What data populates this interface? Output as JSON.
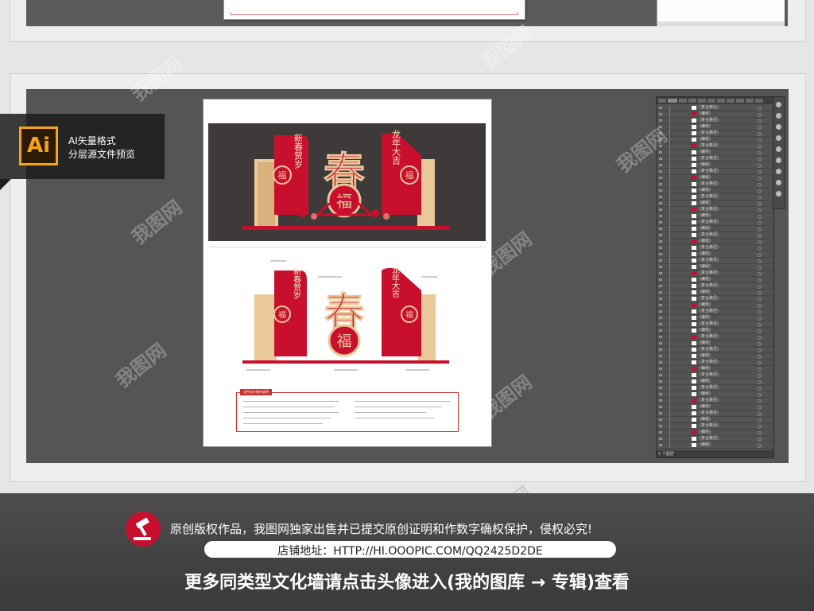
{
  "badge": {
    "logo_text": "Ai",
    "line1": "AI矢量格式",
    "line2": "分层源文件预览"
  },
  "watermark": "我图网",
  "design": {
    "main_character": "春",
    "fu_character": "福",
    "left_banner": "新春贺岁",
    "right_banner": "龙年大吉",
    "plan_title": "文件设计制作说明"
  },
  "layers_panel": {
    "footer_text": "1 个图层",
    "layer_names": [
      "(复合路径)",
      "(编组)"
    ]
  },
  "footer": {
    "copyright": "原创版权作品，我图网独家出售并已提交原创证明和作数字确权保护，侵权必究!",
    "shop_label": "店铺地址：HTTP://HI.OOOPIC.COM/QQ2425D2DE",
    "more": "更多同类型文化墙请点击头像进入(我的图库 → 专辑)查看"
  },
  "colors": {
    "brand_red": "#c8102e",
    "ai_orange": "#f7a21b",
    "design_gold": "#e9c89a"
  }
}
